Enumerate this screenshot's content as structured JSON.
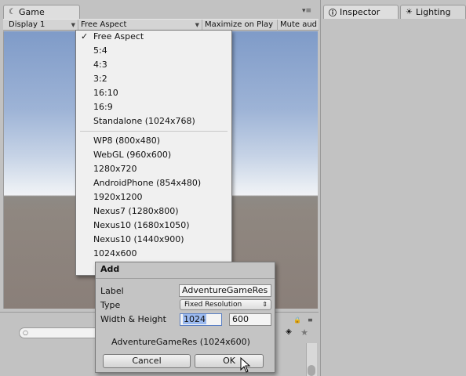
{
  "game": {
    "tab_label": "Game",
    "tab_icon": "game-controller-icon",
    "toolbar": {
      "display": "Display 1",
      "aspect": "Free Aspect",
      "maximize": "Maximize on Play",
      "mute": "Mute aud"
    }
  },
  "inspector": {
    "tab_label": "Inspector",
    "tab_icon": "info-icon",
    "lighting_label": "Lighting",
    "lighting_icon": "lightbulb-icon"
  },
  "aspect_dropdown": {
    "checked_glyph": "✓",
    "items_top": [
      "Free Aspect",
      "5:4",
      "4:3",
      "3:2",
      "16:10",
      "16:9",
      "Standalone (1024x768)"
    ],
    "items_bottom": [
      "WP8 (800x480)",
      "WebGL (960x600)",
      "1280x720",
      "AndroidPhone (854x480)",
      "1920x1200",
      "Nexus7 (1280x800)",
      "Nexus10 (1680x1050)",
      "Nexus10 (1440x900)",
      "1024x600"
    ]
  },
  "add_dialog": {
    "title": "Add",
    "label_caption": "Label",
    "label_value": "AdventureGameRes",
    "type_caption": "Type",
    "type_value": "Fixed Resolution",
    "type_arrow": "⇕",
    "size_caption": "Width & Height",
    "width_value": "1024",
    "height_value": "600",
    "preview": "AdventureGameRes (1024x600)",
    "cancel_label": "Cancel",
    "ok_label": "OK"
  },
  "bottom_panel": {
    "search_glyph": "○"
  },
  "colors": {
    "selection": "#9bbaf0",
    "panel": "#c2c2c2"
  }
}
